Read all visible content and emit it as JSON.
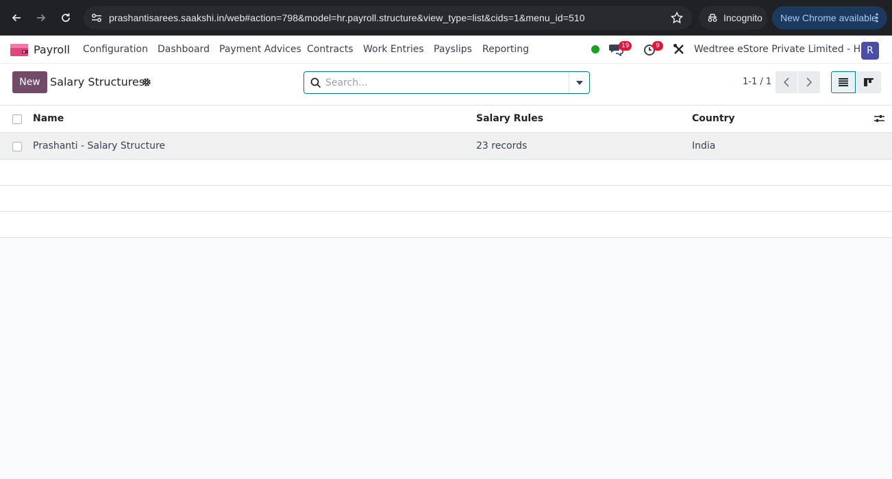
{
  "browser": {
    "url": "prashantisarees.saakshi.in/web#action=798&model=hr.payroll.structure&view_type=list&cids=1&menu_id=510",
    "incognito_label": "Incognito",
    "update_label": "New Chrome available"
  },
  "navbar": {
    "app_name": "Payroll",
    "menu": [
      "Configuration",
      "Dashboard",
      "Payment Advices",
      "Contracts",
      "Work Entries",
      "Payslips",
      "Reporting"
    ],
    "messages_count": "19",
    "activities_count": "9",
    "company": "Wedtree eStore Private Limited - HO",
    "avatar_letter": "R"
  },
  "control_panel": {
    "new_label": "New",
    "breadcrumb": "Salary Structures",
    "search_placeholder": "Search...",
    "pager": "1-1 / 1"
  },
  "list": {
    "columns": [
      "Name",
      "Salary Rules",
      "Country"
    ],
    "rows": [
      {
        "name": "Prashanti - Salary Structure",
        "salary_rules": "23 records",
        "country": "India"
      }
    ]
  },
  "colors": {
    "brand": "#714b67",
    "accent": "#017e84",
    "badge": "#e7133a",
    "online": "#17a224"
  }
}
